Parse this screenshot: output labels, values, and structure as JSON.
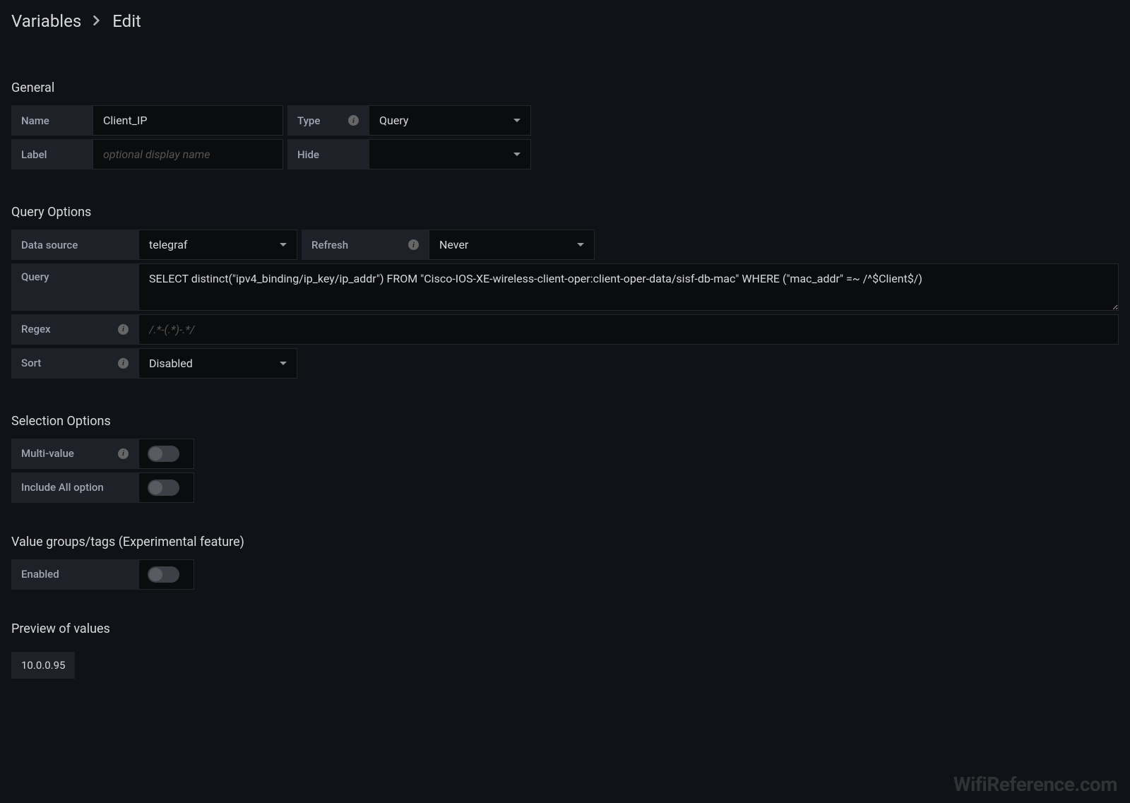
{
  "breadcrumb": {
    "parent": "Variables",
    "current": "Edit"
  },
  "general": {
    "title": "General",
    "name_label": "Name",
    "name_value": "Client_IP",
    "type_label": "Type",
    "type_value": "Query",
    "label_label": "Label",
    "label_placeholder": "optional display name",
    "label_value": "",
    "hide_label": "Hide",
    "hide_value": ""
  },
  "queryOptions": {
    "title": "Query Options",
    "datasource_label": "Data source",
    "datasource_value": "telegraf",
    "refresh_label": "Refresh",
    "refresh_value": "Never",
    "query_label": "Query",
    "query_value": "SELECT distinct(\"ipv4_binding/ip_key/ip_addr\") FROM \"Cisco-IOS-XE-wireless-client-oper:client-oper-data/sisf-db-mac\" WHERE (\"mac_addr\" =~ /^$Client$/)",
    "regex_label": "Regex",
    "regex_placeholder": "/.*-(.*)-.*/",
    "regex_value": "",
    "sort_label": "Sort",
    "sort_value": "Disabled"
  },
  "selectionOptions": {
    "title": "Selection Options",
    "multivalue_label": "Multi-value",
    "multivalue_on": false,
    "includeall_label": "Include All option",
    "includeall_on": false
  },
  "valueGroups": {
    "title": "Value groups/tags (Experimental feature)",
    "enabled_label": "Enabled",
    "enabled_on": false
  },
  "preview": {
    "title": "Preview of values",
    "values": [
      "10.0.0.95"
    ]
  },
  "watermark": "WifiReference.com"
}
